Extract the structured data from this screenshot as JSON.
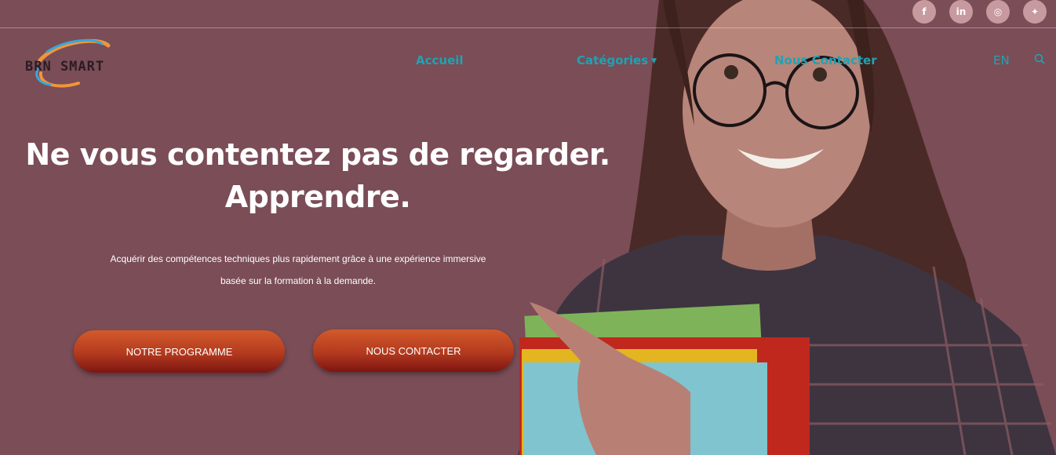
{
  "topbar": {
    "social": [
      {
        "icon": "facebook-icon",
        "glyph": "f"
      },
      {
        "icon": "linkedin-icon",
        "glyph": "in"
      },
      {
        "icon": "instagram-icon",
        "glyph": "◎"
      },
      {
        "icon": "twitter-icon",
        "glyph": "✦"
      }
    ]
  },
  "brand": {
    "logo_text": "BRN SMART"
  },
  "nav": {
    "home": "Accueil",
    "categories": "Catégories",
    "contact": "Nous Contacter",
    "lang": "EN"
  },
  "hero": {
    "headline_line1": "Ne vous contentez pas de regarder.",
    "headline_line2": "Apprendre.",
    "sub_line1": "Acquérir des compétences techniques plus rapidement grâce à une expérience immersive",
    "sub_line2": "basée sur la formation à la demande.",
    "btn_program": "NOTRE PROGRAMME",
    "btn_contact": "NOUS CONTACTER"
  },
  "colors": {
    "background": "#7a4d57",
    "nav_link": "#1fa3b3",
    "social_bg": "#c79aa0",
    "button_top": "#d35a2b",
    "button_bottom": "#7e1512"
  }
}
